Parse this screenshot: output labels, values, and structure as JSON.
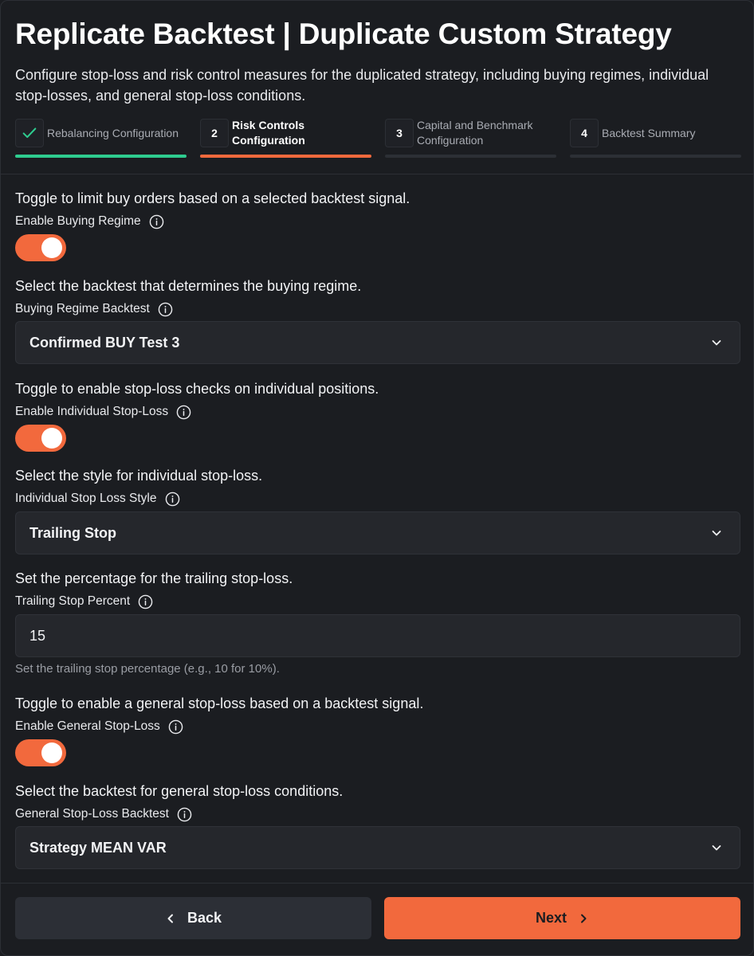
{
  "header": {
    "title": "Replicate Backtest | Duplicate Custom Strategy",
    "subtitle": "Configure stop-loss and risk control measures for the duplicated strategy, including buying regimes, individual stop-losses, and general stop-loss conditions."
  },
  "steps": [
    {
      "number": "",
      "label": "Rebalancing Configuration",
      "status": "completed",
      "icon": "check-icon"
    },
    {
      "number": "2",
      "label": "Risk Controls Configuration",
      "status": "active"
    },
    {
      "number": "3",
      "label": "Capital and Benchmark Configuration",
      "status": "pending"
    },
    {
      "number": "4",
      "label": "Backtest Summary",
      "status": "pending"
    }
  ],
  "form": {
    "buying_regime": {
      "description": "Toggle to limit buy orders based on a selected backtest signal.",
      "label": "Enable Buying Regime",
      "enabled": true
    },
    "buying_regime_backtest": {
      "description": "Select the backtest that determines the buying regime.",
      "label": "Buying Regime Backtest",
      "value": "Confirmed BUY Test 3"
    },
    "individual_stop_loss": {
      "description": "Toggle to enable stop-loss checks on individual positions.",
      "label": "Enable Individual Stop-Loss",
      "enabled": true
    },
    "individual_stop_loss_style": {
      "description": "Select the style for individual stop-loss.",
      "label": "Individual Stop Loss Style",
      "value": "Trailing Stop"
    },
    "trailing_stop_percent": {
      "description": "Set the percentage for the trailing stop-loss.",
      "label": "Trailing Stop Percent",
      "value": "15",
      "helper": "Set the trailing stop percentage (e.g., 10 for 10%)."
    },
    "general_stop_loss": {
      "description": "Toggle to enable a general stop-loss based on a backtest signal.",
      "label": "Enable General Stop-Loss",
      "enabled": true
    },
    "general_stop_loss_backtest": {
      "description": "Select the backtest for general stop-loss conditions.",
      "label": "General Stop-Loss Backtest",
      "value": "Strategy MEAN VAR"
    }
  },
  "footer": {
    "back_label": "Back",
    "next_label": "Next"
  },
  "colors": {
    "background": "#1b1d21",
    "accent": "#f2693d",
    "success": "#2ecc8f",
    "field": "#25272c"
  }
}
